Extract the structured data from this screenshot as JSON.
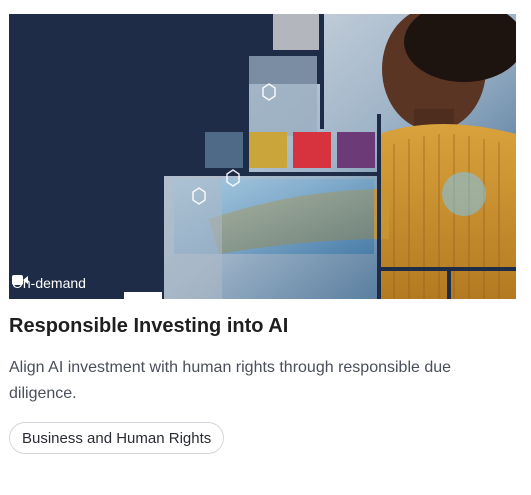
{
  "card": {
    "badge": {
      "icon": "video-camera-icon",
      "label": "On-demand"
    },
    "title": "Responsible Investing into AI",
    "description": "Align AI investment with human rights through responsible due diligence.",
    "tag": "Business and Human Rights"
  },
  "colors": {
    "hero_navy": "#1e2c48",
    "tile_slate": "#4f6a86",
    "tile_gold": "#c9a53a",
    "tile_red": "#d7333f",
    "tile_purple": "#6d3a78"
  }
}
